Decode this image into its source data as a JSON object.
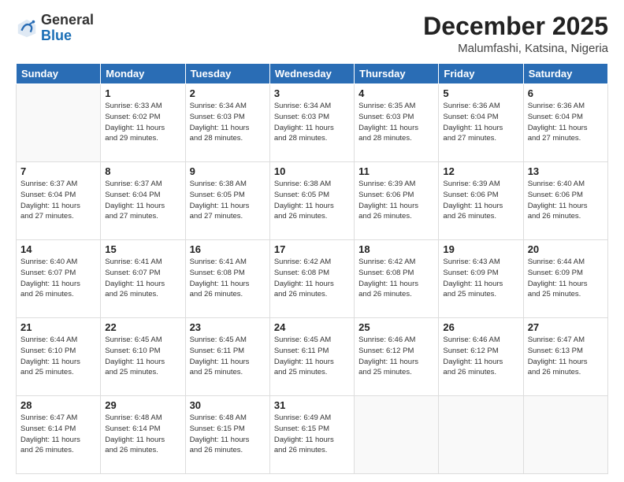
{
  "header": {
    "logo_line1": "General",
    "logo_line2": "Blue",
    "title": "December 2025",
    "subtitle": "Malumfashi, Katsina, Nigeria"
  },
  "weekdays": [
    "Sunday",
    "Monday",
    "Tuesday",
    "Wednesday",
    "Thursday",
    "Friday",
    "Saturday"
  ],
  "weeks": [
    [
      {
        "day": "",
        "info": ""
      },
      {
        "day": "1",
        "info": "Sunrise: 6:33 AM\nSunset: 6:02 PM\nDaylight: 11 hours\nand 29 minutes."
      },
      {
        "day": "2",
        "info": "Sunrise: 6:34 AM\nSunset: 6:03 PM\nDaylight: 11 hours\nand 28 minutes."
      },
      {
        "day": "3",
        "info": "Sunrise: 6:34 AM\nSunset: 6:03 PM\nDaylight: 11 hours\nand 28 minutes."
      },
      {
        "day": "4",
        "info": "Sunrise: 6:35 AM\nSunset: 6:03 PM\nDaylight: 11 hours\nand 28 minutes."
      },
      {
        "day": "5",
        "info": "Sunrise: 6:36 AM\nSunset: 6:04 PM\nDaylight: 11 hours\nand 27 minutes."
      },
      {
        "day": "6",
        "info": "Sunrise: 6:36 AM\nSunset: 6:04 PM\nDaylight: 11 hours\nand 27 minutes."
      }
    ],
    [
      {
        "day": "7",
        "info": "Sunrise: 6:37 AM\nSunset: 6:04 PM\nDaylight: 11 hours\nand 27 minutes."
      },
      {
        "day": "8",
        "info": "Sunrise: 6:37 AM\nSunset: 6:04 PM\nDaylight: 11 hours\nand 27 minutes."
      },
      {
        "day": "9",
        "info": "Sunrise: 6:38 AM\nSunset: 6:05 PM\nDaylight: 11 hours\nand 27 minutes."
      },
      {
        "day": "10",
        "info": "Sunrise: 6:38 AM\nSunset: 6:05 PM\nDaylight: 11 hours\nand 26 minutes."
      },
      {
        "day": "11",
        "info": "Sunrise: 6:39 AM\nSunset: 6:06 PM\nDaylight: 11 hours\nand 26 minutes."
      },
      {
        "day": "12",
        "info": "Sunrise: 6:39 AM\nSunset: 6:06 PM\nDaylight: 11 hours\nand 26 minutes."
      },
      {
        "day": "13",
        "info": "Sunrise: 6:40 AM\nSunset: 6:06 PM\nDaylight: 11 hours\nand 26 minutes."
      }
    ],
    [
      {
        "day": "14",
        "info": "Sunrise: 6:40 AM\nSunset: 6:07 PM\nDaylight: 11 hours\nand 26 minutes."
      },
      {
        "day": "15",
        "info": "Sunrise: 6:41 AM\nSunset: 6:07 PM\nDaylight: 11 hours\nand 26 minutes."
      },
      {
        "day": "16",
        "info": "Sunrise: 6:41 AM\nSunset: 6:08 PM\nDaylight: 11 hours\nand 26 minutes."
      },
      {
        "day": "17",
        "info": "Sunrise: 6:42 AM\nSunset: 6:08 PM\nDaylight: 11 hours\nand 26 minutes."
      },
      {
        "day": "18",
        "info": "Sunrise: 6:42 AM\nSunset: 6:08 PM\nDaylight: 11 hours\nand 26 minutes."
      },
      {
        "day": "19",
        "info": "Sunrise: 6:43 AM\nSunset: 6:09 PM\nDaylight: 11 hours\nand 25 minutes."
      },
      {
        "day": "20",
        "info": "Sunrise: 6:44 AM\nSunset: 6:09 PM\nDaylight: 11 hours\nand 25 minutes."
      }
    ],
    [
      {
        "day": "21",
        "info": "Sunrise: 6:44 AM\nSunset: 6:10 PM\nDaylight: 11 hours\nand 25 minutes."
      },
      {
        "day": "22",
        "info": "Sunrise: 6:45 AM\nSunset: 6:10 PM\nDaylight: 11 hours\nand 25 minutes."
      },
      {
        "day": "23",
        "info": "Sunrise: 6:45 AM\nSunset: 6:11 PM\nDaylight: 11 hours\nand 25 minutes."
      },
      {
        "day": "24",
        "info": "Sunrise: 6:45 AM\nSunset: 6:11 PM\nDaylight: 11 hours\nand 25 minutes."
      },
      {
        "day": "25",
        "info": "Sunrise: 6:46 AM\nSunset: 6:12 PM\nDaylight: 11 hours\nand 25 minutes."
      },
      {
        "day": "26",
        "info": "Sunrise: 6:46 AM\nSunset: 6:12 PM\nDaylight: 11 hours\nand 26 minutes."
      },
      {
        "day": "27",
        "info": "Sunrise: 6:47 AM\nSunset: 6:13 PM\nDaylight: 11 hours\nand 26 minutes."
      }
    ],
    [
      {
        "day": "28",
        "info": "Sunrise: 6:47 AM\nSunset: 6:14 PM\nDaylight: 11 hours\nand 26 minutes."
      },
      {
        "day": "29",
        "info": "Sunrise: 6:48 AM\nSunset: 6:14 PM\nDaylight: 11 hours\nand 26 minutes."
      },
      {
        "day": "30",
        "info": "Sunrise: 6:48 AM\nSunset: 6:15 PM\nDaylight: 11 hours\nand 26 minutes."
      },
      {
        "day": "31",
        "info": "Sunrise: 6:49 AM\nSunset: 6:15 PM\nDaylight: 11 hours\nand 26 minutes."
      },
      {
        "day": "",
        "info": ""
      },
      {
        "day": "",
        "info": ""
      },
      {
        "day": "",
        "info": ""
      }
    ]
  ]
}
